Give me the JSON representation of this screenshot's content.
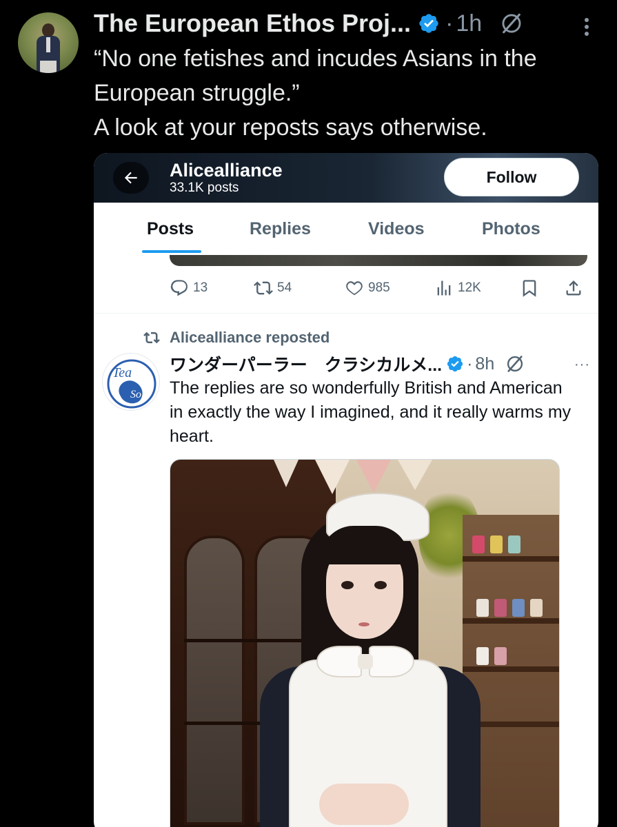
{
  "outer_tweet": {
    "author_name": "The European Ethos Proj...",
    "separator": "·",
    "time": "1h",
    "text": "“No one fetishes and incudes Asians in the European struggle.”\nA look at your reposts says otherwise."
  },
  "embedded_profile": {
    "name": "Alicealliance",
    "post_count": "33.1K posts",
    "follow_label": "Follow",
    "tabs": [
      {
        "label": "Posts",
        "active": true
      },
      {
        "label": "Replies",
        "active": false
      },
      {
        "label": "Videos",
        "active": false
      },
      {
        "label": "Photos",
        "active": false
      }
    ]
  },
  "previous_post_actions": {
    "replies": "13",
    "reposts": "54",
    "likes": "985",
    "views": "12K"
  },
  "reposted_post": {
    "repost_label": "Alicealliance reposted",
    "author_name": "ワンダーパーラー　クラシカルメ...",
    "separator": "·",
    "time": "8h",
    "more": "···",
    "text": "The replies are so wonderfully British and American in exactly the way I imagined, and it really warms my heart.",
    "avatar_text": "Tea So"
  },
  "colors": {
    "accent": "#1d9bf0",
    "verified": "#1d9bf0",
    "text_dark": "#0f1419",
    "muted": "#536471",
    "background": "#000000"
  }
}
